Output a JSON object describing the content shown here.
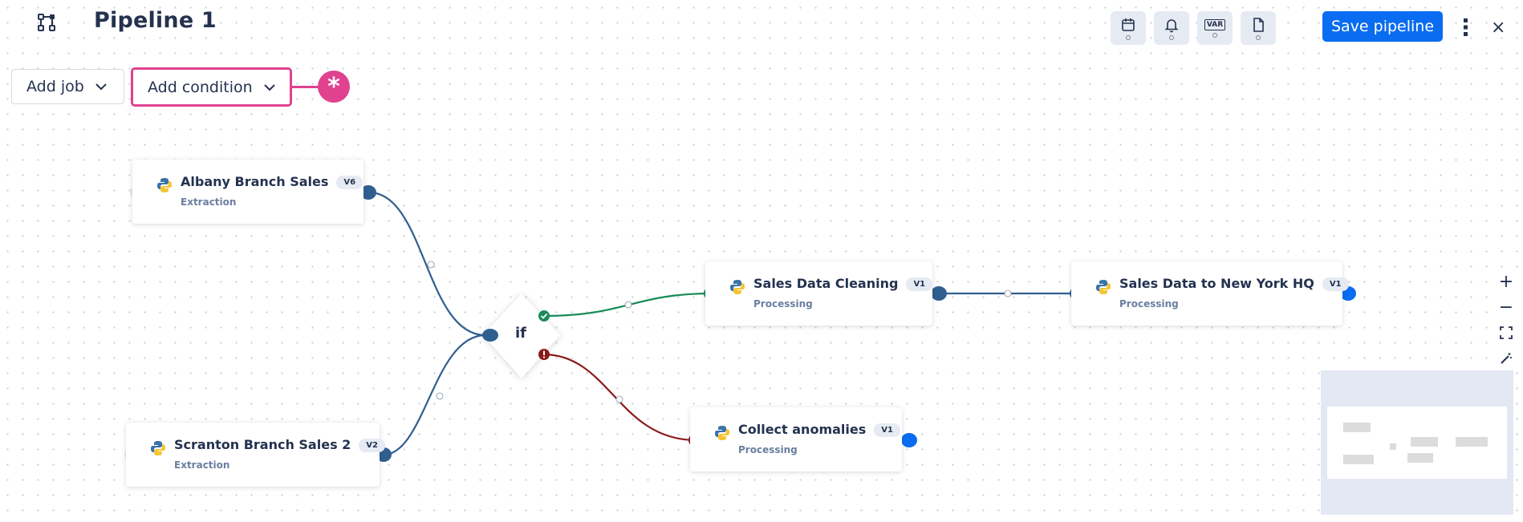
{
  "header": {
    "title": "Pipeline 1",
    "save_label": "Save pipeline",
    "var_label": "VAR",
    "close_glyph": "×"
  },
  "toolbar": {
    "add_job_label": "Add job",
    "add_condition_label": "Add condition",
    "asterisk": "*"
  },
  "nodes": [
    {
      "name": "Albany Branch Sales",
      "version": "V6",
      "type": "Extraction"
    },
    {
      "name": "Scranton Branch Sales 2",
      "version": "V2",
      "type": "Extraction"
    },
    {
      "name": "Sales Data Cleaning",
      "version": "V1",
      "type": "Processing"
    },
    {
      "name": "Sales Data to New York HQ",
      "version": "V1",
      "type": "Processing"
    },
    {
      "name": "Collect anomalies",
      "version": "V1",
      "type": "Processing"
    }
  ],
  "condition": {
    "label": "if"
  },
  "zoom": {
    "in": "+",
    "out": "−"
  },
  "colors": {
    "accent": "#0a6cf0",
    "highlight": "#e0428f",
    "edge_default": "#2f5f8f",
    "edge_success": "#1a8a5a",
    "edge_error": "#8b1a1a"
  },
  "icons": [
    "app-pipeline-icon",
    "calendar-icon",
    "bell-icon",
    "variables-icon",
    "document-icon",
    "kebab-menu-icon",
    "close-icon",
    "python-icon",
    "check-icon",
    "error-icon",
    "fit-view-icon",
    "magic-wand-icon"
  ]
}
